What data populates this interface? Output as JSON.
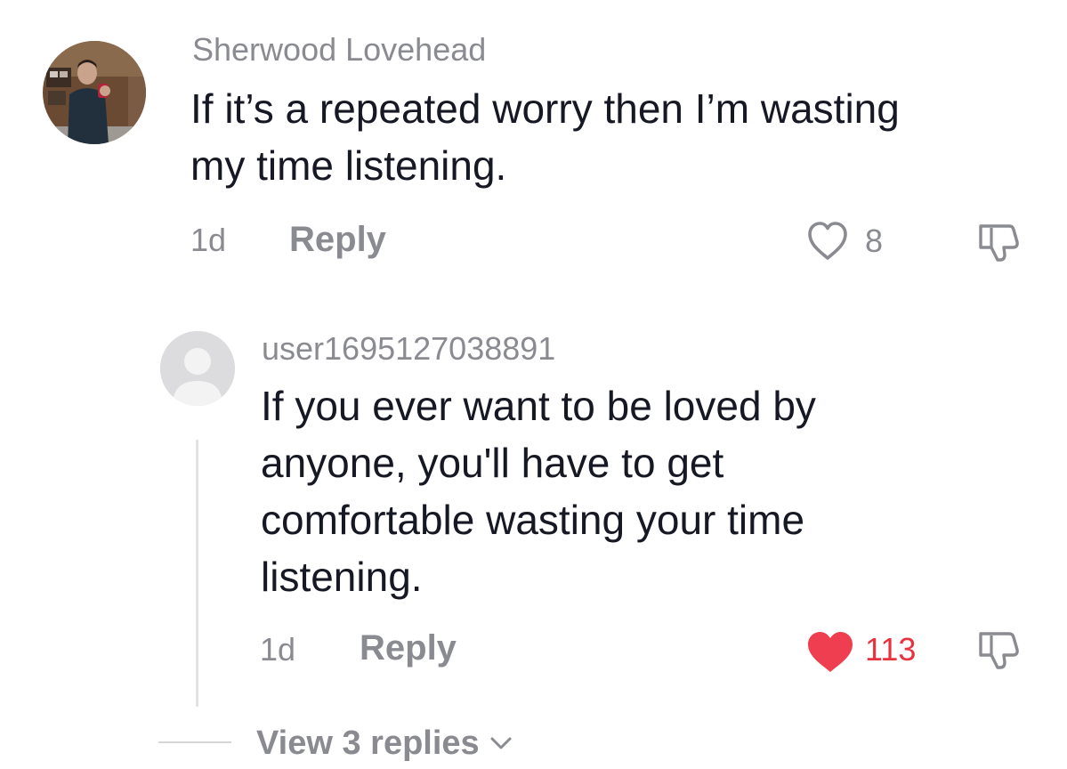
{
  "comments": [
    {
      "username": "Sherwood Lovehead",
      "text_line1": "If it’s a repeated worry then I’m wasting",
      "text_line2": "my time listening.",
      "time": "1d",
      "reply_label": "Reply",
      "likes": "8",
      "liked": false
    },
    {
      "username": "user1695127038891",
      "text_line1": "If you ever want to be loved by",
      "text_line2": "anyone, you'll have to get",
      "text_line3": "comfortable wasting your time",
      "text_line4": "listening.",
      "time": "1d",
      "reply_label": "Reply",
      "likes": "113",
      "liked": true
    }
  ],
  "view_replies": {
    "label": "View 3 replies"
  },
  "colors": {
    "like_active": "#e8323f",
    "muted_text": "#8a8b91",
    "primary_text": "#161823"
  },
  "icons": {
    "like": "heart-icon",
    "dislike": "thumbs-down-icon",
    "expand": "chevron-down-icon"
  }
}
